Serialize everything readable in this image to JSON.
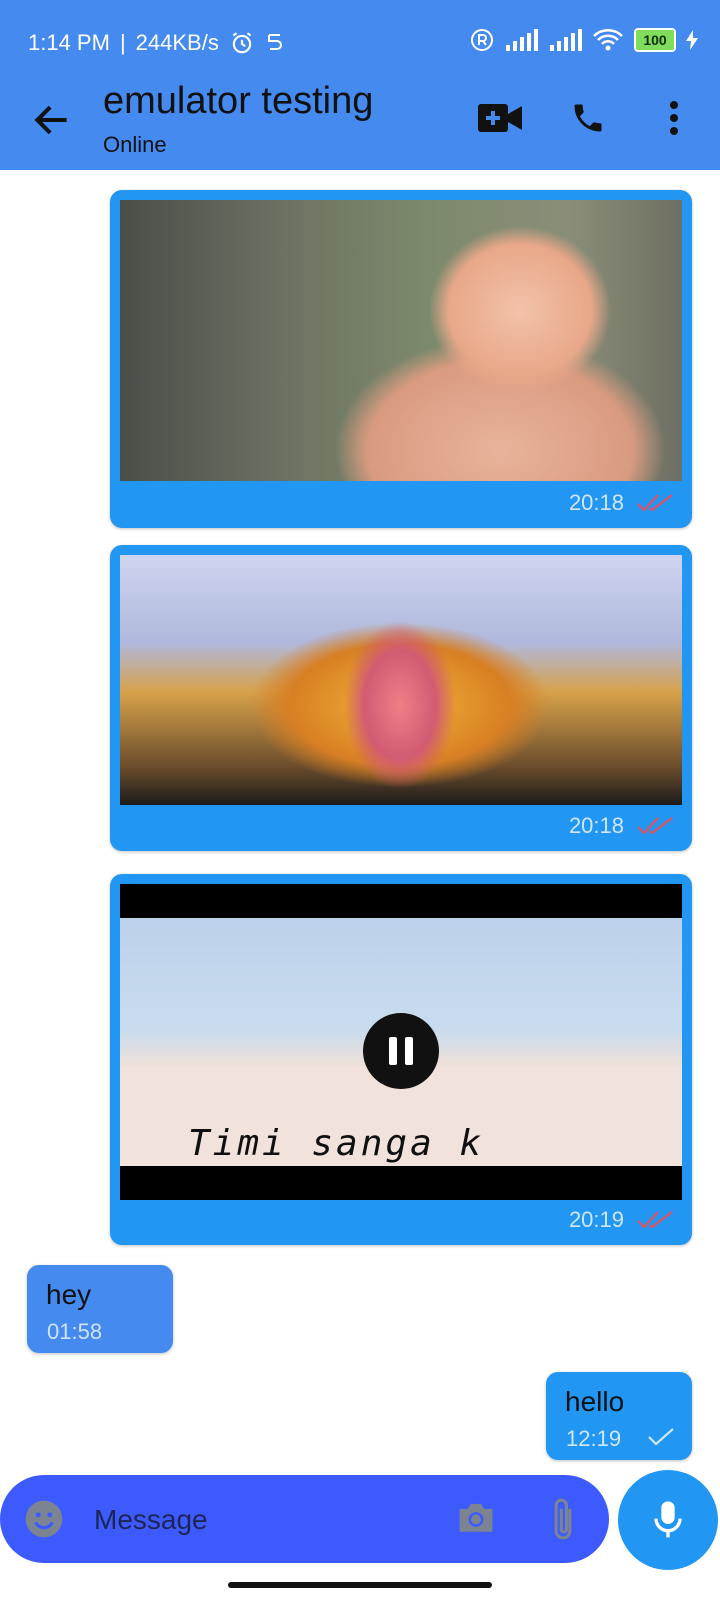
{
  "status_bar": {
    "time": "1:14 PM",
    "speed": "244KB/s",
    "battery": "100"
  },
  "header": {
    "title": "emulator testing",
    "subtitle": "Online",
    "icons": [
      "back-arrow-icon",
      "video-call-icon",
      "phone-icon",
      "more-vert-icon"
    ]
  },
  "messages": [
    {
      "type": "image",
      "time": "20:18",
      "status": "read"
    },
    {
      "type": "image",
      "time": "20:18",
      "status": "read"
    },
    {
      "type": "video",
      "time": "20:19",
      "status": "read",
      "caption": "Timi sanga k"
    },
    {
      "type": "text",
      "direction": "incoming",
      "text": "hey",
      "time": "01:58"
    },
    {
      "type": "text",
      "direction": "outgoing",
      "text": "hello",
      "time": "12:19",
      "status": "sent"
    }
  ],
  "composer": {
    "placeholder": "Message",
    "icons": [
      "emoji-icon",
      "camera-icon",
      "attachment-icon",
      "microphone-icon"
    ]
  },
  "colors": {
    "app_bar": "#448aef",
    "outgoing_bubble": "#2196f3",
    "incoming_bubble": "#448aef",
    "composer": "#3d5afe",
    "read_tick": "#e0525e"
  }
}
